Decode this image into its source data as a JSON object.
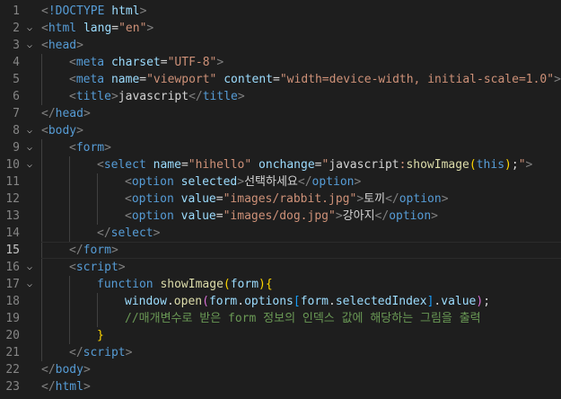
{
  "editor": {
    "current_line": 15,
    "lines": [
      {
        "n": 1,
        "fold": false,
        "indent": 0,
        "tokens": [
          [
            "p",
            "<"
          ],
          [
            "t",
            "!DOCTYPE"
          ],
          [
            "x",
            " "
          ],
          [
            "a",
            "html"
          ],
          [
            "p",
            ">"
          ]
        ]
      },
      {
        "n": 2,
        "fold": true,
        "indent": 0,
        "tokens": [
          [
            "p",
            "<"
          ],
          [
            "t",
            "html"
          ],
          [
            "x",
            " "
          ],
          [
            "a",
            "lang"
          ],
          [
            "x",
            "="
          ],
          [
            "s",
            "\"en\""
          ],
          [
            "p",
            ">"
          ]
        ]
      },
      {
        "n": 3,
        "fold": true,
        "indent": 0,
        "tokens": [
          [
            "p",
            "<"
          ],
          [
            "t",
            "head"
          ],
          [
            "p",
            ">"
          ]
        ]
      },
      {
        "n": 4,
        "fold": false,
        "indent": 1,
        "tokens": [
          [
            "p",
            "<"
          ],
          [
            "t",
            "meta"
          ],
          [
            "x",
            " "
          ],
          [
            "a",
            "charset"
          ],
          [
            "x",
            "="
          ],
          [
            "s",
            "\"UTF-8\""
          ],
          [
            "p",
            ">"
          ]
        ]
      },
      {
        "n": 5,
        "fold": false,
        "indent": 1,
        "tokens": [
          [
            "p",
            "<"
          ],
          [
            "t",
            "meta"
          ],
          [
            "x",
            " "
          ],
          [
            "a",
            "name"
          ],
          [
            "x",
            "="
          ],
          [
            "s",
            "\"viewport\""
          ],
          [
            "x",
            " "
          ],
          [
            "a",
            "content"
          ],
          [
            "x",
            "="
          ],
          [
            "s",
            "\"width=device-width, initial-scale=1.0\""
          ],
          [
            "p",
            ">"
          ]
        ]
      },
      {
        "n": 6,
        "fold": false,
        "indent": 1,
        "tokens": [
          [
            "p",
            "<"
          ],
          [
            "t",
            "title"
          ],
          [
            "p",
            ">"
          ],
          [
            "x",
            "javascript"
          ],
          [
            "p",
            "</"
          ],
          [
            "t",
            "title"
          ],
          [
            "p",
            ">"
          ]
        ]
      },
      {
        "n": 7,
        "fold": false,
        "indent": 0,
        "tokens": [
          [
            "p",
            "</"
          ],
          [
            "t",
            "head"
          ],
          [
            "p",
            ">"
          ]
        ]
      },
      {
        "n": 8,
        "fold": true,
        "indent": 0,
        "tokens": [
          [
            "p",
            "<"
          ],
          [
            "t",
            "body"
          ],
          [
            "p",
            ">"
          ]
        ]
      },
      {
        "n": 9,
        "fold": true,
        "indent": 1,
        "tokens": [
          [
            "p",
            "<"
          ],
          [
            "t",
            "form"
          ],
          [
            "p",
            ">"
          ]
        ]
      },
      {
        "n": 10,
        "fold": true,
        "indent": 2,
        "tokens": [
          [
            "p",
            "<"
          ],
          [
            "t",
            "select"
          ],
          [
            "x",
            " "
          ],
          [
            "a",
            "name"
          ],
          [
            "x",
            "="
          ],
          [
            "s",
            "\"hihello\""
          ],
          [
            "x",
            " "
          ],
          [
            "a",
            "onchange"
          ],
          [
            "x",
            "="
          ],
          [
            "s",
            "\""
          ],
          [
            "x",
            "javascript"
          ],
          [
            "s",
            ":"
          ],
          [
            "f",
            "showImage"
          ],
          [
            "b1",
            "("
          ],
          [
            "k",
            "this"
          ],
          [
            "b1",
            ")"
          ],
          [
            "x",
            ";"
          ],
          [
            "s",
            "\""
          ],
          [
            "p",
            ">"
          ]
        ]
      },
      {
        "n": 11,
        "fold": false,
        "indent": 3,
        "tokens": [
          [
            "p",
            "<"
          ],
          [
            "t",
            "option"
          ],
          [
            "x",
            " "
          ],
          [
            "a",
            "selected"
          ],
          [
            "p",
            ">"
          ],
          [
            "x",
            "선택하세요"
          ],
          [
            "p",
            "</"
          ],
          [
            "t",
            "option"
          ],
          [
            "p",
            ">"
          ]
        ]
      },
      {
        "n": 12,
        "fold": false,
        "indent": 3,
        "tokens": [
          [
            "p",
            "<"
          ],
          [
            "t",
            "option"
          ],
          [
            "x",
            " "
          ],
          [
            "a",
            "value"
          ],
          [
            "x",
            "="
          ],
          [
            "s",
            "\"images/rabbit.jpg\""
          ],
          [
            "p",
            ">"
          ],
          [
            "x",
            "토끼"
          ],
          [
            "p",
            "</"
          ],
          [
            "t",
            "option"
          ],
          [
            "p",
            ">"
          ]
        ]
      },
      {
        "n": 13,
        "fold": false,
        "indent": 3,
        "tokens": [
          [
            "p",
            "<"
          ],
          [
            "t",
            "option"
          ],
          [
            "x",
            " "
          ],
          [
            "a",
            "value"
          ],
          [
            "x",
            "="
          ],
          [
            "s",
            "\"images/dog.jpg\""
          ],
          [
            "p",
            ">"
          ],
          [
            "x",
            "강아지"
          ],
          [
            "p",
            "</"
          ],
          [
            "t",
            "option"
          ],
          [
            "p",
            ">"
          ]
        ]
      },
      {
        "n": 14,
        "fold": false,
        "indent": 2,
        "tokens": [
          [
            "p",
            "</"
          ],
          [
            "t",
            "select"
          ],
          [
            "p",
            ">"
          ]
        ]
      },
      {
        "n": 15,
        "fold": false,
        "indent": 1,
        "tokens": [
          [
            "p",
            "</"
          ],
          [
            "t",
            "form"
          ],
          [
            "p",
            ">"
          ]
        ]
      },
      {
        "n": 16,
        "fold": true,
        "indent": 1,
        "tokens": [
          [
            "p",
            "<"
          ],
          [
            "t",
            "script"
          ],
          [
            "p",
            ">"
          ]
        ]
      },
      {
        "n": 17,
        "fold": true,
        "indent": 2,
        "tokens": [
          [
            "k",
            "function"
          ],
          [
            "x",
            " "
          ],
          [
            "f",
            "showImage"
          ],
          [
            "b1",
            "("
          ],
          [
            "v",
            "form"
          ],
          [
            "b1",
            ")"
          ],
          [
            "b1",
            "{"
          ]
        ]
      },
      {
        "n": 18,
        "fold": false,
        "indent": 3,
        "tokens": [
          [
            "v",
            "window"
          ],
          [
            "x",
            "."
          ],
          [
            "f",
            "open"
          ],
          [
            "b2",
            "("
          ],
          [
            "v",
            "form"
          ],
          [
            "x",
            "."
          ],
          [
            "v",
            "options"
          ],
          [
            "b3",
            "["
          ],
          [
            "v",
            "form"
          ],
          [
            "x",
            "."
          ],
          [
            "v",
            "selectedIndex"
          ],
          [
            "b3",
            "]"
          ],
          [
            "x",
            "."
          ],
          [
            "v",
            "value"
          ],
          [
            "b2",
            ")"
          ],
          [
            "x",
            ";"
          ]
        ]
      },
      {
        "n": 19,
        "fold": false,
        "indent": 3,
        "tokens": [
          [
            "c",
            "//매개변수로 받은 form 정보의 인덱스 값에 해당하는 그림을 출력"
          ]
        ]
      },
      {
        "n": 20,
        "fold": false,
        "indent": 2,
        "tokens": [
          [
            "b1",
            "}"
          ]
        ]
      },
      {
        "n": 21,
        "fold": false,
        "indent": 1,
        "tokens": [
          [
            "p",
            "</"
          ],
          [
            "t",
            "script"
          ],
          [
            "p",
            ">"
          ]
        ]
      },
      {
        "n": 22,
        "fold": false,
        "indent": 0,
        "tokens": [
          [
            "p",
            "</"
          ],
          [
            "t",
            "body"
          ],
          [
            "p",
            ">"
          ]
        ]
      },
      {
        "n": 23,
        "fold": false,
        "indent": 0,
        "tokens": [
          [
            "p",
            "</"
          ],
          [
            "t",
            "html"
          ],
          [
            "p",
            ">"
          ]
        ]
      }
    ]
  },
  "icons": {
    "fold": "chevron-down-icon"
  },
  "colors": {
    "background": "#1e1e1e",
    "tag": "#569cd6",
    "punctuation": "#808080",
    "attribute": "#9cdcfe",
    "string": "#ce9178",
    "function": "#dcdcaa",
    "comment": "#6a9955",
    "bracket_level1": "#ffd700",
    "bracket_level2": "#da70d6",
    "bracket_level3": "#179fff"
  }
}
